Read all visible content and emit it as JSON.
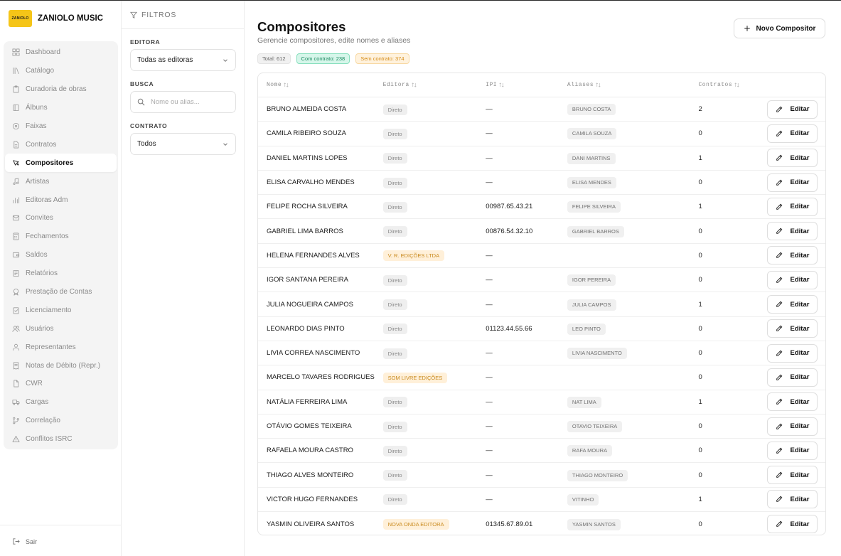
{
  "brand": {
    "logo_text": "ZANIOLO",
    "name": "ZANIOLO MUSIC"
  },
  "nav": [
    {
      "label": "Dashboard",
      "icon": "grid-icon",
      "active": false
    },
    {
      "label": "Catálogo",
      "icon": "library-icon",
      "active": false
    },
    {
      "label": "Curadoria de obras",
      "icon": "clipboard-icon",
      "active": false
    },
    {
      "label": "Álbuns",
      "icon": "book-icon",
      "active": false
    },
    {
      "label": "Faixas",
      "icon": "disc-icon",
      "active": false
    },
    {
      "label": "Contratos",
      "icon": "file-icon",
      "active": false
    },
    {
      "label": "Compositores",
      "icon": "pen-tool-icon",
      "active": true
    },
    {
      "label": "Artistas",
      "icon": "music-icon",
      "active": false
    },
    {
      "label": "Editoras Adm",
      "icon": "bar-chart-icon",
      "active": false
    },
    {
      "label": "Convites",
      "icon": "mail-icon",
      "active": false
    },
    {
      "label": "Fechamentos",
      "icon": "calculator-icon",
      "active": false
    },
    {
      "label": "Saldos",
      "icon": "wallet-icon",
      "active": false
    },
    {
      "label": "Relatórios",
      "icon": "report-icon",
      "active": false
    },
    {
      "label": "Prestação de Contas",
      "icon": "badge-icon",
      "active": false
    },
    {
      "label": "Licenciamento",
      "icon": "clipboard-check-icon",
      "active": false
    },
    {
      "label": "Usuários",
      "icon": "users-icon",
      "active": false
    },
    {
      "label": "Representantes",
      "icon": "user-tie-icon",
      "active": false
    },
    {
      "label": "Notas de Débito (Repr.)",
      "icon": "receipt-icon",
      "active": false
    },
    {
      "label": "CWR",
      "icon": "cwr-file-icon",
      "active": false
    },
    {
      "label": "Cargas",
      "icon": "truck-icon",
      "active": false
    },
    {
      "label": "Correlação",
      "icon": "git-branch-icon",
      "active": false
    },
    {
      "label": "Conflitos ISRC",
      "icon": "alert-triangle-icon",
      "active": false
    }
  ],
  "logout_label": "Sair",
  "filters": {
    "title": "FILTROS",
    "editora_label": "EDITORA",
    "editora_value": "Todas as editoras",
    "busca_label": "BUSCA",
    "busca_placeholder": "Nome ou alias...",
    "contrato_label": "CONTRATO",
    "contrato_value": "Todos"
  },
  "page": {
    "title": "Compositores",
    "subtitle": "Gerencie compositores, edite nomes e aliases",
    "new_button": "Novo Compositor"
  },
  "stats": {
    "total": "Total: 612",
    "com_contrato": "Com contrato: 238",
    "sem_contrato": "Sem contrato: 374"
  },
  "table": {
    "headers": {
      "nome": "Nome",
      "editora": "Editora",
      "ipi": "IPI",
      "aliases": "Aliases",
      "contratos": "Contratos"
    },
    "edit_label": "Editar",
    "rows": [
      {
        "nome": "BRUNO ALMEIDA COSTA",
        "editora": "Direto",
        "ipi": "—",
        "alias": "BRUNO COSTA",
        "contratos": "2"
      },
      {
        "nome": "CAMILA RIBEIRO SOUZA",
        "editora": "Direto",
        "ipi": "—",
        "alias": "CAMILA SOUZA",
        "contratos": "0"
      },
      {
        "nome": "DANIEL MARTINS LOPES",
        "editora": "Direto",
        "ipi": "—",
        "alias": "DANI MARTINS",
        "contratos": "1"
      },
      {
        "nome": "ELISA CARVALHO MENDES",
        "editora": "Direto",
        "ipi": "—",
        "alias": "ELISA MENDES",
        "contratos": "0"
      },
      {
        "nome": "FELIPE ROCHA SILVEIRA",
        "editora": "Direto",
        "ipi": "00987.65.43.21",
        "alias": "FELIPE SILVEIRA",
        "contratos": "1"
      },
      {
        "nome": "GABRIEL LIMA BARROS",
        "editora": "Direto",
        "ipi": "00876.54.32.10",
        "alias": "GABRIEL BARROS",
        "contratos": "0"
      },
      {
        "nome": "HELENA FERNANDES ALVES",
        "editora": "V. R. EDIÇÕES LTDA",
        "ipi": "—",
        "alias": "",
        "contratos": "0"
      },
      {
        "nome": "IGOR SANTANA PEREIRA",
        "editora": "Direto",
        "ipi": "—",
        "alias": "IGOR PEREIRA",
        "contratos": "0"
      },
      {
        "nome": "JULIA NOGUEIRA CAMPOS",
        "editora": "Direto",
        "ipi": "—",
        "alias": "JULIA CAMPOS",
        "contratos": "1"
      },
      {
        "nome": "LEONARDO DIAS PINTO",
        "editora": "Direto",
        "ipi": "01123.44.55.66",
        "alias": "LEO PINTO",
        "contratos": "0"
      },
      {
        "nome": "LIVIA CORREA NASCIMENTO",
        "editora": "Direto",
        "ipi": "—",
        "alias": "LIVIA NASCIMENTO",
        "contratos": "0"
      },
      {
        "nome": "MARCELO TAVARES RODRIGUES",
        "editora": "SOM LIVRE EDIÇÕES",
        "ipi": "—",
        "alias": "",
        "contratos": "0"
      },
      {
        "nome": "NATÁLIA FERREIRA LIMA",
        "editora": "Direto",
        "ipi": "—",
        "alias": "NAT LIMA",
        "contratos": "1"
      },
      {
        "nome": "OTÁVIO GOMES TEIXEIRA",
        "editora": "Direto",
        "ipi": "—",
        "alias": "OTAVIO TEIXEIRA",
        "contratos": "0"
      },
      {
        "nome": "RAFAELA MOURA CASTRO",
        "editora": "Direto",
        "ipi": "—",
        "alias": "RAFA MOURA",
        "contratos": "0"
      },
      {
        "nome": "THIAGO ALVES MONTEIRO",
        "editora": "Direto",
        "ipi": "—",
        "alias": "THIAGO MONTEIRO",
        "contratos": "0"
      },
      {
        "nome": "VICTOR HUGO FERNANDES",
        "editora": "Direto",
        "ipi": "—",
        "alias": "VITINHO",
        "contratos": "1"
      },
      {
        "nome": "YASMIN OLIVEIRA SANTOS",
        "editora": "NOVA ONDA EDITORA",
        "ipi": "01345.67.89.01",
        "alias": "YASMIN SANTOS",
        "contratos": "0"
      }
    ]
  },
  "colors": {
    "brand_yellow": "#f5c518",
    "green_badge": "#1c8a61",
    "orange_badge": "#d58d1a"
  }
}
